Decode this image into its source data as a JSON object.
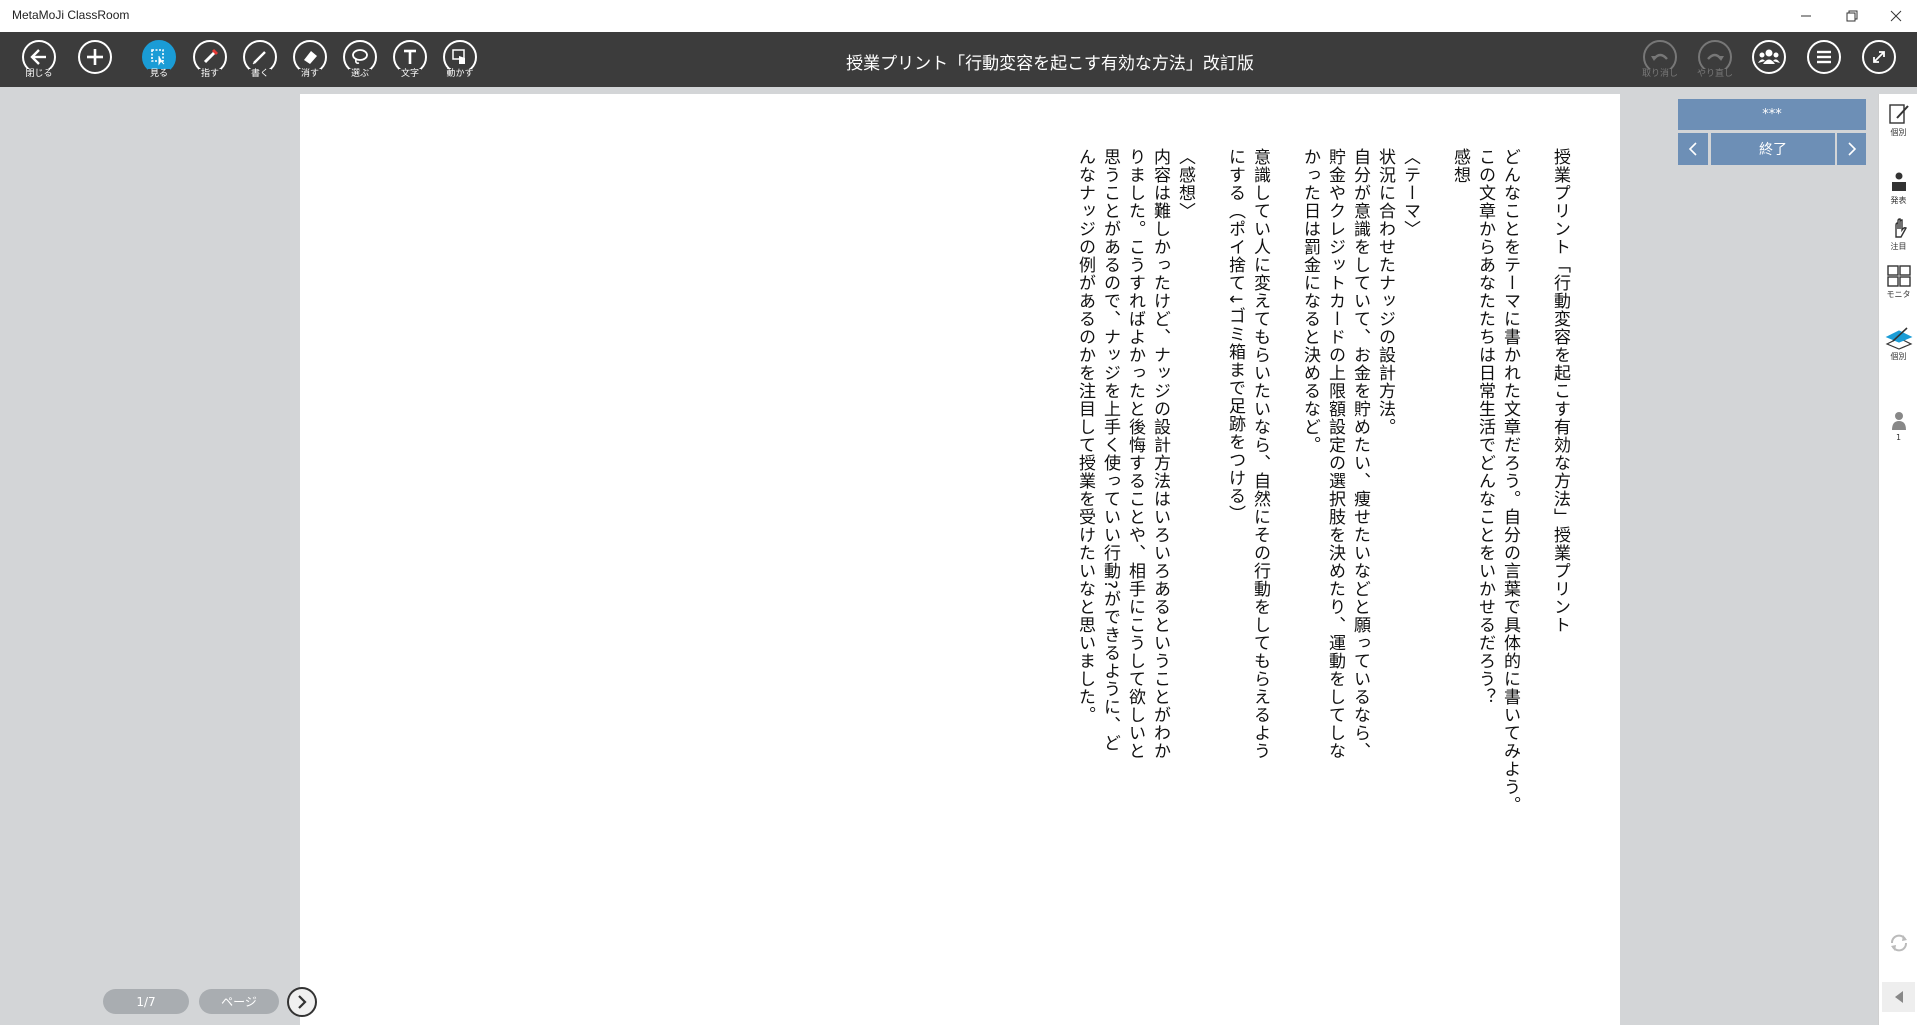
{
  "window": {
    "app_title": "MetaMoJi ClassRoom"
  },
  "toolbar": {
    "left_tools": [
      {
        "label": "閉じる",
        "icon": "back-arrow-icon"
      },
      {
        "label": "",
        "icon": "plus-icon"
      },
      {
        "label": "見る",
        "icon": "view-icon",
        "active": true
      },
      {
        "label": "指す",
        "icon": "pointer-pen-icon"
      },
      {
        "label": "書く",
        "icon": "pen-icon"
      },
      {
        "label": "消す",
        "icon": "eraser-icon"
      },
      {
        "label": "選ぶ",
        "icon": "lasso-icon"
      },
      {
        "label": "文字",
        "icon": "text-icon"
      },
      {
        "label": "動かす",
        "icon": "move-hand-icon"
      }
    ],
    "undo_label": "取り消し",
    "redo_label": "やり直し",
    "doc_title": "授業プリント「行動変容を起こす有効な方法」改訂版"
  },
  "document": {
    "columns": [
      "授業プリント「行動変容を起こす有効な方法」授業プリント",
      "",
      "どんなことをテーマに書かれた文章だろう。自分の言葉で具体的に書いてみよう。",
      "この文章からあなたたちは日常生活でどんなことをいかせるだろう？",
      "感想",
      "",
      "〈テーマ〉",
      "状況に合わせたナッジの設計方法。",
      "自分が意識をしていて、お金を貯めたい、痩せたいなどと願っているなら、",
      "貯金やクレジットカードの上限額設定の選択肢を決めたり、運動をしてしな",
      "かった日は罰金になると決めるなど。",
      "",
      "意識してい人に変えてもらいたいなら、自然にその行動をしてもらえるよう",
      "にする（ポイ捨て↓ゴミ箱まで足跡をつける）",
      "",
      "〈感想〉",
      "内容は難しかったけど、ナッジの設計方法はいろいろあるということがわか",
      "りました。こうすればよかったと後悔することや、相手にこうして欲しいと",
      "思うことがあるので、ナッジを上手く使っていい行動?ができるように、ど",
      "んなナッジの例があるのかを注目して授業を受けたいなと思いました。"
    ]
  },
  "panel": {
    "header": "***",
    "end_label": "終了"
  },
  "sidebar": {
    "items": [
      {
        "label": "個別",
        "icon": "write-pen-icon"
      },
      {
        "label": "発表",
        "icon": "presenter-icon"
      },
      {
        "label": "注目",
        "icon": "attention-hand-icon"
      },
      {
        "label": "モニタ",
        "icon": "monitor-grid-icon"
      },
      {
        "label": "個別",
        "icon": "layers-icon"
      },
      {
        "label": "1",
        "icon": "person-icon"
      }
    ]
  },
  "footer": {
    "page_indicator": "1/7",
    "page_button": "ページ"
  },
  "colors": {
    "toolbar_bg": "#3c3c3c",
    "accent": "#1a9cd6",
    "panel_blue": "#6d8fb6",
    "workspace_bg": "#d3d5d7"
  }
}
